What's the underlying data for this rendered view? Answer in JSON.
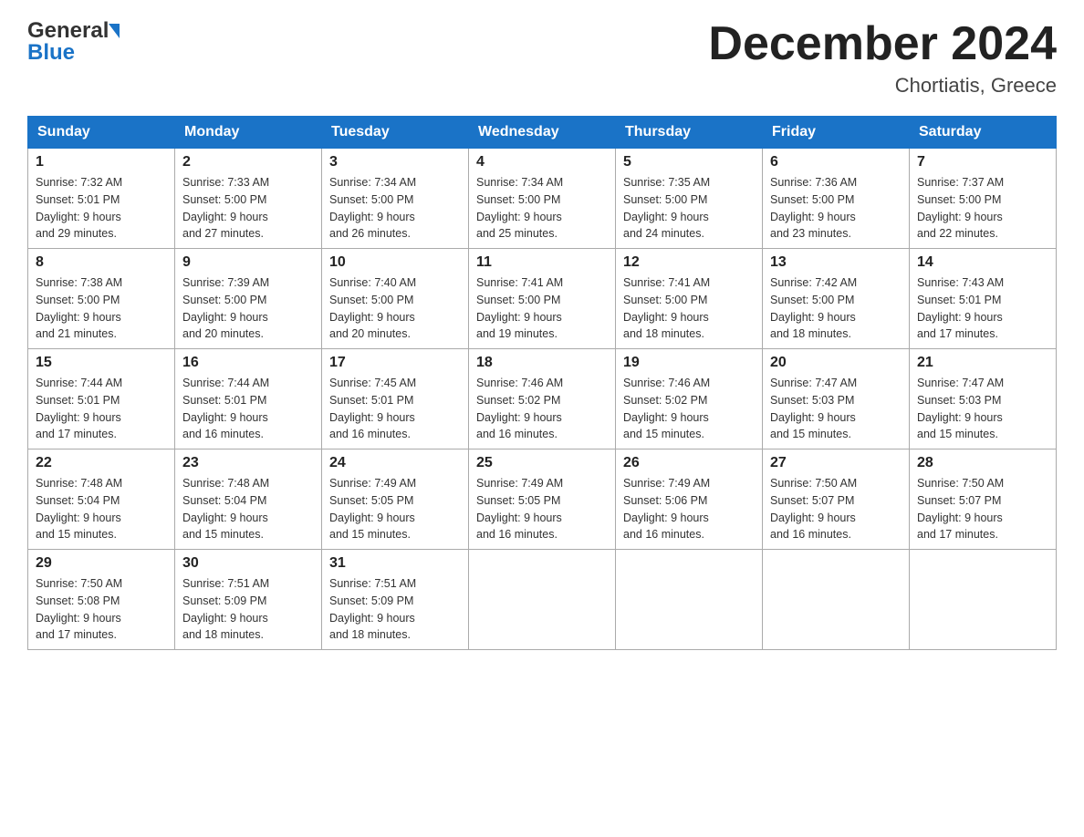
{
  "header": {
    "logo_general": "General",
    "logo_blue": "Blue",
    "month_title": "December 2024",
    "location": "Chortiatis, Greece"
  },
  "calendar": {
    "days_of_week": [
      "Sunday",
      "Monday",
      "Tuesday",
      "Wednesday",
      "Thursday",
      "Friday",
      "Saturday"
    ],
    "weeks": [
      [
        {
          "day": "1",
          "sunrise": "7:32 AM",
          "sunset": "5:01 PM",
          "daylight": "9 hours and 29 minutes."
        },
        {
          "day": "2",
          "sunrise": "7:33 AM",
          "sunset": "5:00 PM",
          "daylight": "9 hours and 27 minutes."
        },
        {
          "day": "3",
          "sunrise": "7:34 AM",
          "sunset": "5:00 PM",
          "daylight": "9 hours and 26 minutes."
        },
        {
          "day": "4",
          "sunrise": "7:34 AM",
          "sunset": "5:00 PM",
          "daylight": "9 hours and 25 minutes."
        },
        {
          "day": "5",
          "sunrise": "7:35 AM",
          "sunset": "5:00 PM",
          "daylight": "9 hours and 24 minutes."
        },
        {
          "day": "6",
          "sunrise": "7:36 AM",
          "sunset": "5:00 PM",
          "daylight": "9 hours and 23 minutes."
        },
        {
          "day": "7",
          "sunrise": "7:37 AM",
          "sunset": "5:00 PM",
          "daylight": "9 hours and 22 minutes."
        }
      ],
      [
        {
          "day": "8",
          "sunrise": "7:38 AM",
          "sunset": "5:00 PM",
          "daylight": "9 hours and 21 minutes."
        },
        {
          "day": "9",
          "sunrise": "7:39 AM",
          "sunset": "5:00 PM",
          "daylight": "9 hours and 20 minutes."
        },
        {
          "day": "10",
          "sunrise": "7:40 AM",
          "sunset": "5:00 PM",
          "daylight": "9 hours and 20 minutes."
        },
        {
          "day": "11",
          "sunrise": "7:41 AM",
          "sunset": "5:00 PM",
          "daylight": "9 hours and 19 minutes."
        },
        {
          "day": "12",
          "sunrise": "7:41 AM",
          "sunset": "5:00 PM",
          "daylight": "9 hours and 18 minutes."
        },
        {
          "day": "13",
          "sunrise": "7:42 AM",
          "sunset": "5:00 PM",
          "daylight": "9 hours and 18 minutes."
        },
        {
          "day": "14",
          "sunrise": "7:43 AM",
          "sunset": "5:01 PM",
          "daylight": "9 hours and 17 minutes."
        }
      ],
      [
        {
          "day": "15",
          "sunrise": "7:44 AM",
          "sunset": "5:01 PM",
          "daylight": "9 hours and 17 minutes."
        },
        {
          "day": "16",
          "sunrise": "7:44 AM",
          "sunset": "5:01 PM",
          "daylight": "9 hours and 16 minutes."
        },
        {
          "day": "17",
          "sunrise": "7:45 AM",
          "sunset": "5:01 PM",
          "daylight": "9 hours and 16 minutes."
        },
        {
          "day": "18",
          "sunrise": "7:46 AM",
          "sunset": "5:02 PM",
          "daylight": "9 hours and 16 minutes."
        },
        {
          "day": "19",
          "sunrise": "7:46 AM",
          "sunset": "5:02 PM",
          "daylight": "9 hours and 15 minutes."
        },
        {
          "day": "20",
          "sunrise": "7:47 AM",
          "sunset": "5:03 PM",
          "daylight": "9 hours and 15 minutes."
        },
        {
          "day": "21",
          "sunrise": "7:47 AM",
          "sunset": "5:03 PM",
          "daylight": "9 hours and 15 minutes."
        }
      ],
      [
        {
          "day": "22",
          "sunrise": "7:48 AM",
          "sunset": "5:04 PM",
          "daylight": "9 hours and 15 minutes."
        },
        {
          "day": "23",
          "sunrise": "7:48 AM",
          "sunset": "5:04 PM",
          "daylight": "9 hours and 15 minutes."
        },
        {
          "day": "24",
          "sunrise": "7:49 AM",
          "sunset": "5:05 PM",
          "daylight": "9 hours and 15 minutes."
        },
        {
          "day": "25",
          "sunrise": "7:49 AM",
          "sunset": "5:05 PM",
          "daylight": "9 hours and 16 minutes."
        },
        {
          "day": "26",
          "sunrise": "7:49 AM",
          "sunset": "5:06 PM",
          "daylight": "9 hours and 16 minutes."
        },
        {
          "day": "27",
          "sunrise": "7:50 AM",
          "sunset": "5:07 PM",
          "daylight": "9 hours and 16 minutes."
        },
        {
          "day": "28",
          "sunrise": "7:50 AM",
          "sunset": "5:07 PM",
          "daylight": "9 hours and 17 minutes."
        }
      ],
      [
        {
          "day": "29",
          "sunrise": "7:50 AM",
          "sunset": "5:08 PM",
          "daylight": "9 hours and 17 minutes."
        },
        {
          "day": "30",
          "sunrise": "7:51 AM",
          "sunset": "5:09 PM",
          "daylight": "9 hours and 18 minutes."
        },
        {
          "day": "31",
          "sunrise": "7:51 AM",
          "sunset": "5:09 PM",
          "daylight": "9 hours and 18 minutes."
        },
        null,
        null,
        null,
        null
      ]
    ]
  }
}
